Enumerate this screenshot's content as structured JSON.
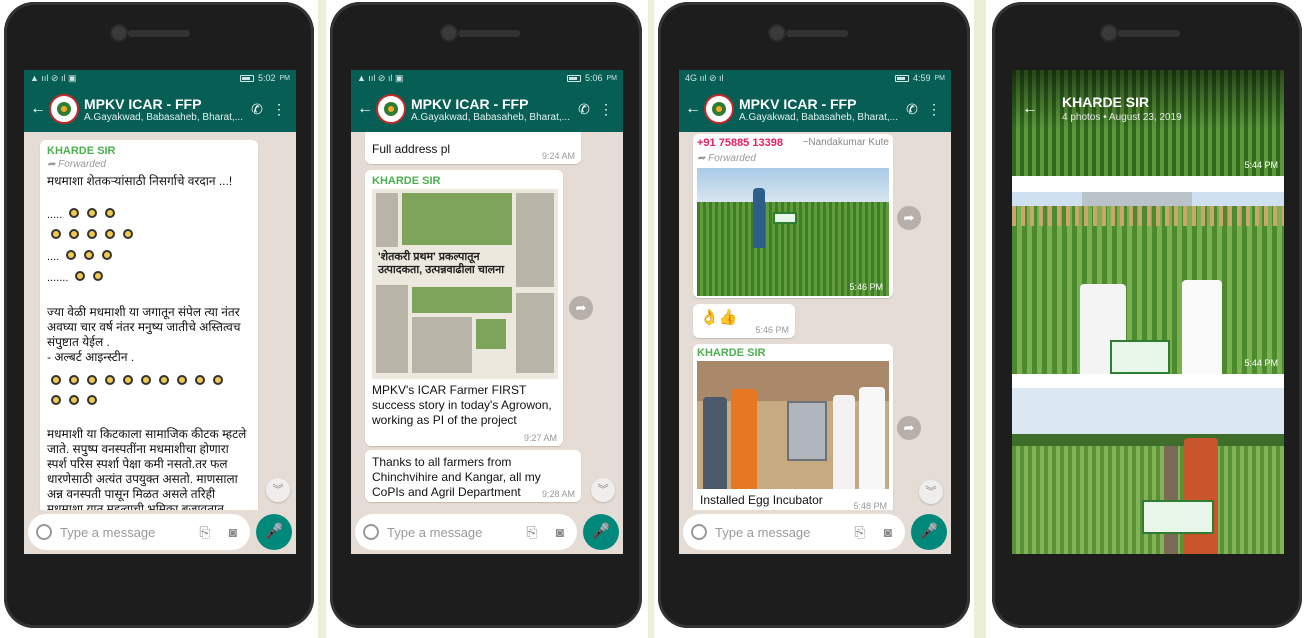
{
  "chat": {
    "title": "MPKV ICAR - FFP",
    "subtitle": "A.Gayakwad, Babasaheb, Bharat,...",
    "input_placeholder": "Type a message"
  },
  "icons": {
    "back": "arrow-back-icon",
    "add_call": "add-call-icon",
    "menu": "more-vert-icon",
    "emoji": "emoji-icon",
    "attach": "paperclip-icon",
    "camera": "camera-icon",
    "mic": "mic-icon",
    "forward": "forward-icon",
    "scroll_down": "chevron-double-down-icon"
  },
  "colors": {
    "header": "#075e54",
    "accent": "#00897b",
    "sender_green": "#4caf50",
    "sender_pink": "#e91e63"
  },
  "screens": [
    {
      "status_time": "5:02",
      "status_ampm": "PM",
      "messages": {
        "m1": {
          "sender": "KHARDE SIR",
          "forwarded": "Forwarded",
          "title_line": "मधमाशा शेतकऱ्यांसाठी निसर्गाचे वरदान ...!",
          "para1": "ज्या वेळी  मधमाशी  या जगातून  संपेल त्या नंतर अवघ्या चार वर्ष नंतर मनुष्य  जातीचे अस्तित्वच संपुष्टात येईल .\n- अल्बर्ट आइन्स्टीन .",
          "para2": "मधमाशी या किटकाला सामाजिक कीटक म्हटले जाते. सपुष्प वनस्पतींना मधमाशीचा होणारा स्पर्श परिस स्पर्शा पेक्षा कमी नसतो.तर  फल धारणेसाठी अत्यंत उपयुक्त असतो. माणसाला अन्न वनस्पती पासून मिळत असले    तरिही मधमाशा यात महत्वाची भूमिका बजावतात. म्हणूनच आपल्या सर्वांवर मधमाशीचे मोठे"
        }
      }
    },
    {
      "status_time": "5:06",
      "status_ampm": "PM",
      "messages": {
        "m0": {
          "text": "Full address pl",
          "time": "9:24 AM"
        },
        "m1": {
          "sender": "KHARDE SIR",
          "headline": "'शेतकरी प्रथम' प्रकल्पातून उत्पादकता, उत्पन्नवाढीला चालना",
          "caption": "MPKV's ICAR Farmer FIRST success story in today's Agrowon, working as PI of the project",
          "time": "9:27 AM"
        },
        "m2": {
          "text": "Thanks to all farmers from Chinchvihire and Kangar, all my CoPIs and Agril Department",
          "time": "9:28 AM"
        }
      }
    },
    {
      "status_time": "4:59",
      "status_ampm": "PM",
      "messages": {
        "m1": {
          "phone": "+91 75885 13398",
          "alias": "~Nandakumar Kute",
          "forwarded": "Forwarded",
          "time": "5:46 PM"
        },
        "m2": {
          "emoji": "👌👍",
          "time": "5:46 PM"
        },
        "m3": {
          "sender": "KHARDE SIR",
          "caption": "Installed Egg Incubator",
          "time": "5:48 PM"
        }
      }
    },
    {
      "gallery": {
        "title": "KHARDE SIR",
        "photo_count": "4 photos",
        "separator": "•",
        "date": "August 23, 2019",
        "times": [
          "5:44 PM",
          "5:44 PM"
        ]
      }
    }
  ]
}
